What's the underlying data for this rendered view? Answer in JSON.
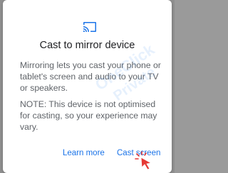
{
  "dialog": {
    "title": "Cast to mirror device",
    "description": "Mirroring lets you cast your phone or tablet's screen and audio to your TV or speakers.",
    "note": "NOTE: This device is not optimised for casting, so your experience may vary.",
    "icon": "cast-icon"
  },
  "actions": {
    "learn_more_label": "Learn more",
    "cast_screen_label": "Cast screen"
  },
  "watermark": {
    "brand": "OneClick Private"
  },
  "colors": {
    "accent": "#1a73e8",
    "title": "#202124",
    "body": "#5f6368",
    "backdrop": "#8f8f8f",
    "cursor": "#e53935"
  }
}
